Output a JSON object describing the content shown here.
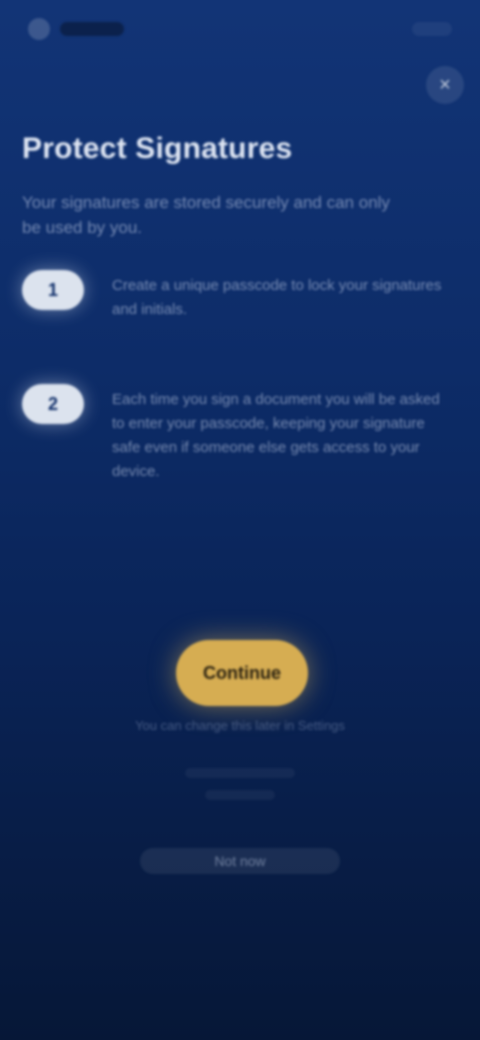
{
  "status": {
    "time": ""
  },
  "header": {
    "close_label": "×"
  },
  "title": "Protect Signatures",
  "subtitle": "Your signatures are stored securely and can only be used by you.",
  "steps": [
    {
      "number": "1",
      "text": "Create a unique passcode to lock your signatures and initials."
    },
    {
      "number": "2",
      "text": "Each time you sign a document you will be asked to enter your passcode, keeping your signature safe even if someone else gets access to your device."
    }
  ],
  "cta": {
    "label": "Continue"
  },
  "footnote": "You can change this later in Settings",
  "bottom_link": "Not now"
}
